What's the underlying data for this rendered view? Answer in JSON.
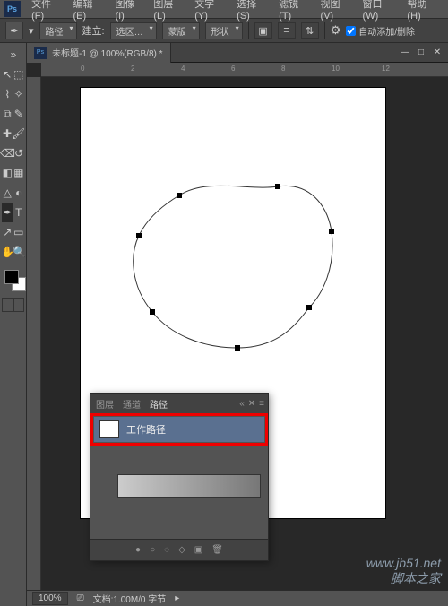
{
  "menubar": {
    "items": [
      "文件(F)",
      "编辑(E)",
      "图像(I)",
      "图层(L)",
      "文字(Y)",
      "选择(S)",
      "滤镜(T)",
      "视图(V)",
      "窗口(W)",
      "帮助(H)"
    ]
  },
  "optionsbar": {
    "mode_label": "路径",
    "make_label": "建立:",
    "btn_selection": "选区…",
    "btn_mask": "蒙版",
    "btn_shape": "形状",
    "auto_add": "自动添加/删除"
  },
  "document": {
    "tab_title": "未标题-1 @ 100%(RGB/8) *"
  },
  "ruler": {
    "marks": [
      "0",
      "2",
      "4",
      "6",
      "8",
      "10",
      "12"
    ]
  },
  "paths_panel": {
    "tabs": [
      "图层",
      "通道",
      "路径"
    ],
    "item_label": "工作路径"
  },
  "statusbar": {
    "zoom": "100%",
    "doc_info": "文档:1.00M/0 字节"
  },
  "watermark": {
    "line1": "www.jb51.net",
    "line2": "脚本之家"
  },
  "icons": {
    "gear": "⚙",
    "menu": "≡",
    "close": "✕",
    "min": "—",
    "max": "□",
    "chev": "▸",
    "fill_circle": "●",
    "stroke_circle": "○",
    "chain": "⛓",
    "square": "■",
    "trash": "🗑",
    "new": "▣",
    "play": "▶"
  },
  "tools": {
    "move": "↖",
    "marquee": "⬚",
    "lasso": "⌇",
    "wand": "✧",
    "crop": "⧉",
    "eyedrop": "✎",
    "heal": "✚",
    "brush": "🖌",
    "stamp": "⌫",
    "history": "↺",
    "eraser": "◧",
    "gradient": "▦",
    "blur": "△",
    "dodge": "◐",
    "pen": "✒",
    "type": "T",
    "path": "↗",
    "shape": "▭",
    "hand": "✋",
    "zoom": "🔍"
  }
}
